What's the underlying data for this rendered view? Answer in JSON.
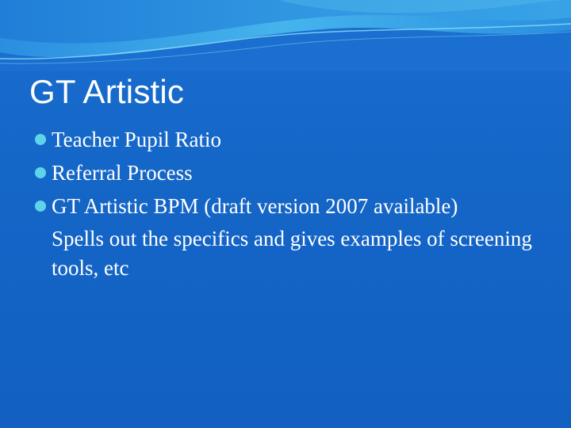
{
  "slide": {
    "title": "GT Artistic",
    "bullets": [
      {
        "text": "Teacher Pupil Ratio"
      },
      {
        "text": "Referral Process"
      },
      {
        "text": "GT Artistic BPM (draft version 2007 available)"
      }
    ],
    "sub_paragraph": "Spells out the specifics and gives examples of screening tools, etc"
  },
  "theme": {
    "background": "#1565c8",
    "bullet_color": "#5fd3ea",
    "text_color": "#ffffff"
  },
  "icons": {
    "bullet": "filled-circle-bullet-icon"
  }
}
